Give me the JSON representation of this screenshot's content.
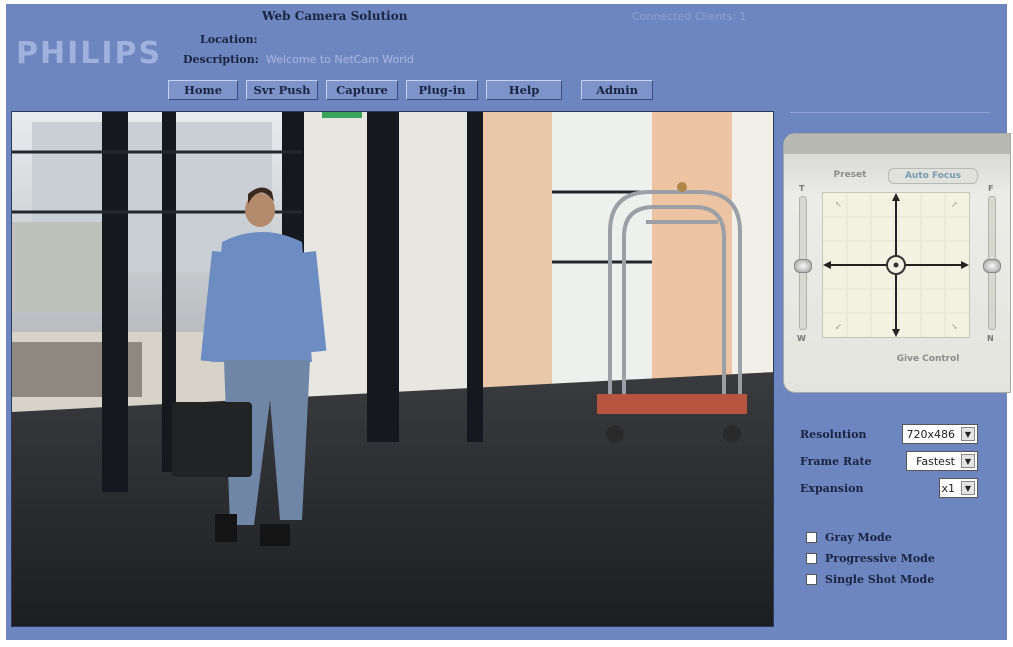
{
  "header": {
    "logo": "PHILIPS",
    "title": "Web Camera Solution",
    "location_label": "Location:",
    "location_value": "",
    "description_label": "Description:",
    "description_value": "Welcome to NetCam World",
    "clients_label": "Connected Clients: 1"
  },
  "nav": {
    "home": "Home",
    "server_push": "Svr Push",
    "capture": "Capture",
    "plugin": "Plug-in",
    "help": "Help",
    "admin": "Admin"
  },
  "ptz": {
    "preset_tab": "Preset",
    "autofocus_tab": "Auto Focus",
    "give_control": "Give Control",
    "left_top": "T",
    "left_bottom": "W",
    "right_top": "F",
    "right_bottom": "N"
  },
  "settings": {
    "resolution_label": "Resolution",
    "resolution_value": "720x486",
    "frame_rate_label": "Frame Rate",
    "frame_rate_value": "Fastest",
    "expansion_label": "Expansion",
    "expansion_value": "x1"
  },
  "modes": {
    "gray": "Gray Mode",
    "progressive": "Progressive Mode",
    "single_shot": "Single Shot Mode"
  },
  "colors": {
    "background": "#6e86bf",
    "text_dark": "#1a2440"
  }
}
